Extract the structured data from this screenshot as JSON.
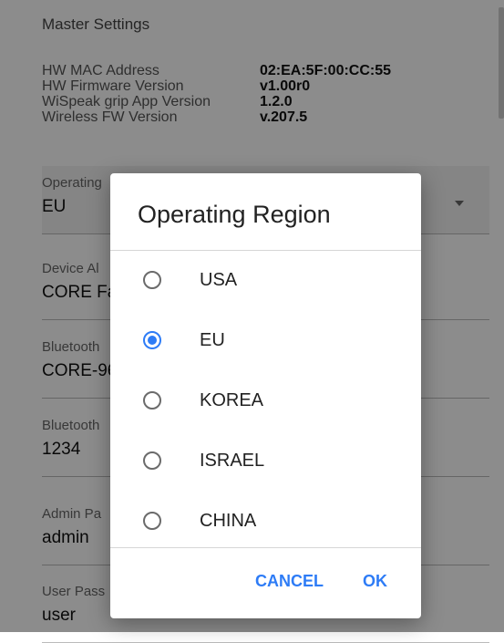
{
  "settings": {
    "section_title": "Master Settings",
    "info": [
      {
        "label": "HW MAC Address",
        "value": "02:EA:5F:00:CC:55"
      },
      {
        "label": "HW Firmware Version",
        "value": "v1.00r0"
      },
      {
        "label": "WiSpeak grip App Version",
        "value": "1.2.0"
      },
      {
        "label": "Wireless FW Version",
        "value": "v.207.5"
      }
    ],
    "fields": [
      {
        "label": "Operating",
        "value": "EU"
      },
      {
        "label": "Device Al",
        "value": "CORE Fa"
      },
      {
        "label": "Bluetooth",
        "value": "CORE-96"
      },
      {
        "label": "Bluetooth",
        "value": "1234"
      },
      {
        "label": "Admin Pa",
        "value": "admin"
      },
      {
        "label": "User Pass",
        "value": "user"
      }
    ]
  },
  "dialog": {
    "title": "Operating Region",
    "options": [
      {
        "label": "USA",
        "selected": false
      },
      {
        "label": "EU",
        "selected": true
      },
      {
        "label": "KOREA",
        "selected": false
      },
      {
        "label": "ISRAEL",
        "selected": false
      },
      {
        "label": "CHINA",
        "selected": false
      }
    ],
    "cancel_label": "CANCEL",
    "ok_label": "OK"
  },
  "colors": {
    "accent": "#2e7cf6",
    "overlay": "rgba(0,0,0,0.45)"
  },
  "icons": {
    "dropdown": "caret-down-icon",
    "radio_checked": "radio-checked-icon",
    "radio_unchecked": "radio-unchecked-icon"
  }
}
